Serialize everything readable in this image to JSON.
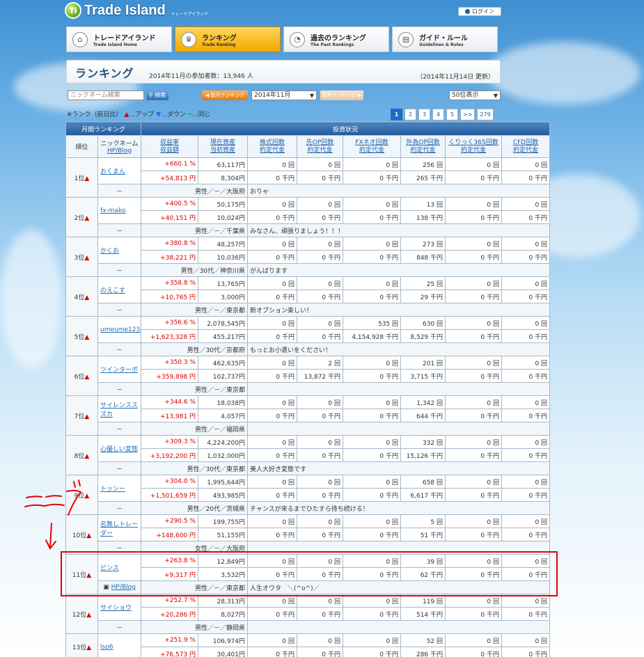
{
  "header": {
    "logo_name": "Trade Island",
    "logo_sub": "トレードアイランド",
    "login_label": "ログイン"
  },
  "nav": [
    {
      "title": "トレードアイランド",
      "sub": "Trade Island Home",
      "icon": "home-icon",
      "glyph": "⌂"
    },
    {
      "title": "ランキング",
      "sub": "Trade Ranking",
      "icon": "crown-icon",
      "glyph": "♛"
    },
    {
      "title": "過去のランキング",
      "sub": "The Past Rankings",
      "icon": "chart-icon",
      "glyph": "◔"
    },
    {
      "title": "ガイド・ルール",
      "sub": "Guidelines & Rules",
      "icon": "book-icon",
      "glyph": "▤"
    }
  ],
  "page": {
    "title": "ランキング",
    "participants": "2014年11月の参加者数：13,946 人",
    "updated": "（2014年11月14日 更新）"
  },
  "controls": {
    "search_placeholder": "ニックネーム検索",
    "search_button": "検索",
    "prev_label": "◀ 前月ランキング",
    "month_selected": "2014年11月",
    "next_label": "翌月ランキング ▶",
    "per_page_selected": "50位表示"
  },
  "legend": {
    "prefix": "※ランク（前日比）",
    "up_symbol": "▲",
    "up": "…アップ",
    "down_symbol": "▼",
    "down": "…ダウン",
    "same_symbol": "━",
    "same": "…同じ"
  },
  "pager": [
    "1",
    "2",
    "3",
    "4",
    "5",
    ">>",
    "279"
  ],
  "table": {
    "group_left": "月間ランキング",
    "group_right": "投資状況",
    "col_rank": "順位",
    "col_nick": "ニックネーム",
    "col_hp": "HP/Blog",
    "cols": [
      [
        "収益率",
        "収益額"
      ],
      [
        "現在資産",
        "当初資産"
      ],
      [
        "株式回数",
        "約定代金"
      ],
      [
        "先OP回数",
        "約定代金"
      ],
      [
        "FXネオ回数",
        "約定代金"
      ],
      [
        "外為OP回数",
        "約定代金"
      ],
      [
        "くりっく365回数",
        "約定代金"
      ],
      [
        "CFD回数",
        "約定代金"
      ]
    ],
    "hp_link": "HP/Blog",
    "rows": [
      {
        "rank": "1位",
        "name": "おくまん",
        "rate": "+660.1 %",
        "gain": "+54,813 円",
        "asset": "63,117円",
        "initial": "8,304円",
        "a": [
          "0 回",
          "0 回",
          "0 回",
          "256 回",
          "0 回",
          "0 回"
        ],
        "b": [
          "0 千円",
          "0 千円",
          "0 千円",
          "265 千円",
          "0 千円",
          "0 千円"
        ],
        "profile": "男性／－／大阪府",
        "comment": "おりゃ",
        "hp": "－"
      },
      {
        "rank": "2位",
        "name": "fx-mako",
        "rate": "+400.5 %",
        "gain": "+40,151 円",
        "asset": "50,175円",
        "initial": "10,024円",
        "a": [
          "0 回",
          "0 回",
          "0 回",
          "13 回",
          "0 回",
          "0 回"
        ],
        "b": [
          "0 千円",
          "0 千円",
          "0 千円",
          "138 千円",
          "0 千円",
          "0 千円"
        ],
        "profile": "男性／－／千葉県",
        "comment": "みなさん、頑張りましょう！！！",
        "hp": "－"
      },
      {
        "rank": "3位",
        "name": "かくお",
        "rate": "+380.8 %",
        "gain": "+38,221 円",
        "asset": "48,257円",
        "initial": "10,036円",
        "a": [
          "0 回",
          "0 回",
          "0 回",
          "273 回",
          "0 回",
          "0 回"
        ],
        "b": [
          "0 千円",
          "0 千円",
          "0 千円",
          "848 千円",
          "0 千円",
          "0 千円"
        ],
        "profile": "男性／30代／神奈川県",
        "comment": "がんばります",
        "hp": "－"
      },
      {
        "rank": "4位",
        "name": "のえこす",
        "rate": "+358.8 %",
        "gain": "+10,765 円",
        "asset": "13,765円",
        "initial": "3,000円",
        "a": [
          "0 回",
          "0 回",
          "0 回",
          "25 回",
          "0 回",
          "0 回"
        ],
        "b": [
          "0 千円",
          "0 千円",
          "0 千円",
          "29 千円",
          "0 千円",
          "0 千円"
        ],
        "profile": "男性／－／東京都",
        "comment": "新オプション楽しい！",
        "hp": "－"
      },
      {
        "rank": "5位",
        "name": "umeume123456777y",
        "rate": "+356.6 %",
        "gain": "+1,623,328 円",
        "asset": "2,078,545円",
        "initial": "455,217円",
        "a": [
          "0 回",
          "0 回",
          "535 回",
          "630 回",
          "0 回",
          "0 回"
        ],
        "b": [
          "0 千円",
          "0 千円",
          "4,154,928 千円",
          "8,529 千円",
          "0 千円",
          "0 千円"
        ],
        "profile": "男性／30代／京都府",
        "comment": "もっとお小遣いをください！",
        "hp": "－"
      },
      {
        "rank": "6位",
        "name": "ツインターボ",
        "rate": "+350.3 %",
        "gain": "+359,898 円",
        "asset": "462,635円",
        "initial": "102,737円",
        "a": [
          "0 回",
          "2 回",
          "0 回",
          "201 回",
          "0 回",
          "0 回"
        ],
        "b": [
          "0 千円",
          "13,872 千円",
          "0 千円",
          "3,715 千円",
          "0 千円",
          "0 千円"
        ],
        "profile": "男性／－／東京都",
        "comment": "",
        "hp": "－"
      },
      {
        "rank": "7位",
        "name": "サイレンススズカ",
        "rate": "+344.6 %",
        "gain": "+13,981 円",
        "asset": "18,038円",
        "initial": "4,057円",
        "a": [
          "0 回",
          "0 回",
          "0 回",
          "1,342 回",
          "0 回",
          "0 回"
        ],
        "b": [
          "0 千円",
          "0 千円",
          "0 千円",
          "644 千円",
          "0 千円",
          "0 千円"
        ],
        "profile": "男性／－／福岡県",
        "comment": "",
        "hp": "－"
      },
      {
        "rank": "8位",
        "name": "心優しい変態",
        "rate": "+309.3 %",
        "gain": "+3,192,200 円",
        "asset": "4,224,200円",
        "initial": "1,032,000円",
        "a": [
          "0 回",
          "0 回",
          "0 回",
          "332 回",
          "0 回",
          "0 回"
        ],
        "b": [
          "0 千円",
          "0 千円",
          "0 千円",
          "15,126 千円",
          "0 千円",
          "0 千円"
        ],
        "profile": "男性／30代／東京都",
        "comment": "美人大好き変態です",
        "hp": "－"
      },
      {
        "rank": "9位",
        "name": "トッシー",
        "rate": "+304.0 %",
        "gain": "+1,501,659 円",
        "asset": "1,995,644円",
        "initial": "493,985円",
        "a": [
          "0 回",
          "0 回",
          "0 回",
          "658 回",
          "0 回",
          "0 回"
        ],
        "b": [
          "0 千円",
          "0 千円",
          "0 千円",
          "6,617 千円",
          "0 千円",
          "0 千円"
        ],
        "profile": "男性／20代／茨城県",
        "comment": "チャンスが来るまでひたすら待ち続ける！",
        "hp": "－"
      },
      {
        "rank": "10位",
        "name": "名無しトレーダー",
        "rate": "+290.5 %",
        "gain": "+148,600 円",
        "asset": "199,755円",
        "initial": "51,155円",
        "a": [
          "0 回",
          "0 回",
          "0 回",
          "5 回",
          "0 回",
          "0 回"
        ],
        "b": [
          "0 千円",
          "0 千円",
          "0 千円",
          "51 千円",
          "0 千円",
          "0 千円"
        ],
        "profile": "女性／－／大阪府",
        "comment": "",
        "hp": "－"
      },
      {
        "rank": "11位",
        "name": "ピンス",
        "rate": "+263.8 %",
        "gain": "+9,317 円",
        "asset": "12,849円",
        "initial": "3,532円",
        "a": [
          "0 回",
          "0 回",
          "0 回",
          "39 回",
          "0 回",
          "0 回"
        ],
        "b": [
          "0 千円",
          "0 千円",
          "0 千円",
          "62 千円",
          "0 千円",
          "0 千円"
        ],
        "profile": "男性／－／東京都",
        "comment": "人生オワタ　＼(^o^)／",
        "hp": "HP/Blog"
      },
      {
        "rank": "12位",
        "name": "サイショウ",
        "rate": "+252.7 %",
        "gain": "+20,286 円",
        "asset": "28,313円",
        "initial": "8,027円",
        "a": [
          "0 回",
          "0 回",
          "0 回",
          "119 回",
          "0 回",
          "0 回"
        ],
        "b": [
          "0 千円",
          "0 千円",
          "0 千円",
          "514 千円",
          "0 千円",
          "0 千円"
        ],
        "profile": "男性／－／静岡県",
        "comment": "",
        "hp": "－"
      },
      {
        "rank": "13位",
        "name": "lso6",
        "rate": "+251.9 %",
        "gain": "+76,573 円",
        "asset": "106,974円",
        "initial": "30,401円",
        "a": [
          "0 回",
          "0 回",
          "0 回",
          "52 回",
          "0 回",
          "0 回"
        ],
        "b": [
          "0 千円",
          "0 千円",
          "0 千円",
          "286 千円",
          "0 千円",
          "0 千円"
        ],
        "profile": "",
        "comment": "",
        "hp": ""
      }
    ]
  },
  "annotation": {
    "handwriting": "ここで",
    "color": "#e60000"
  }
}
